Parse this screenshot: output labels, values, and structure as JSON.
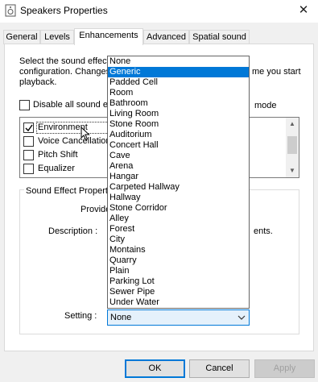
{
  "window": {
    "title": "Speakers Properties",
    "close_glyph": "✕",
    "icon": "speaker-properties-icon"
  },
  "tabs": [
    {
      "label": "General",
      "selected": false
    },
    {
      "label": "Levels",
      "selected": false
    },
    {
      "label": "Enhancements",
      "selected": true
    },
    {
      "label": "Advanced",
      "selected": false
    },
    {
      "label": "Spatial sound",
      "selected": false
    }
  ],
  "enhancements": {
    "description_lines": [
      "Select the sound effect",
      "configuration. Changes",
      "playback."
    ],
    "description_tail": "me you start",
    "disable_label": "Disable all sound eff",
    "disable_tail": "mode",
    "effects": [
      {
        "label": "Environment",
        "checked": true
      },
      {
        "label": "Voice Cancellation",
        "checked": false
      },
      {
        "label": "Pitch Shift",
        "checked": false
      },
      {
        "label": "Equalizer",
        "checked": false
      }
    ],
    "properties": {
      "group_title": "Sound Effect Propert",
      "provider_label": "Provider :",
      "description_label": "Description :",
      "description_tail": "ents.",
      "setting_label": "Setting :",
      "setting_value": "None"
    },
    "dropdown": {
      "highlighted": "Generic",
      "options": [
        "None",
        "Generic",
        "Padded Cell",
        "Room",
        "Bathroom",
        "Living Room",
        "Stone Room",
        "Auditorium",
        "Concert Hall",
        "Cave",
        "Arena",
        "Hangar",
        "Carpeted Hallway",
        "Hallway",
        "Stone Corridor",
        "Alley",
        "Forest",
        "City",
        "Montains",
        "Quarry",
        "Plain",
        "Parking Lot",
        "Sewer Pipe",
        "Under Water"
      ]
    }
  },
  "buttons": {
    "ok": "OK",
    "cancel": "Cancel",
    "apply": "Apply"
  },
  "colors": {
    "accent": "#0078d7",
    "highlight_text": "#ffffff",
    "disabled_text": "#a0a0a0"
  }
}
